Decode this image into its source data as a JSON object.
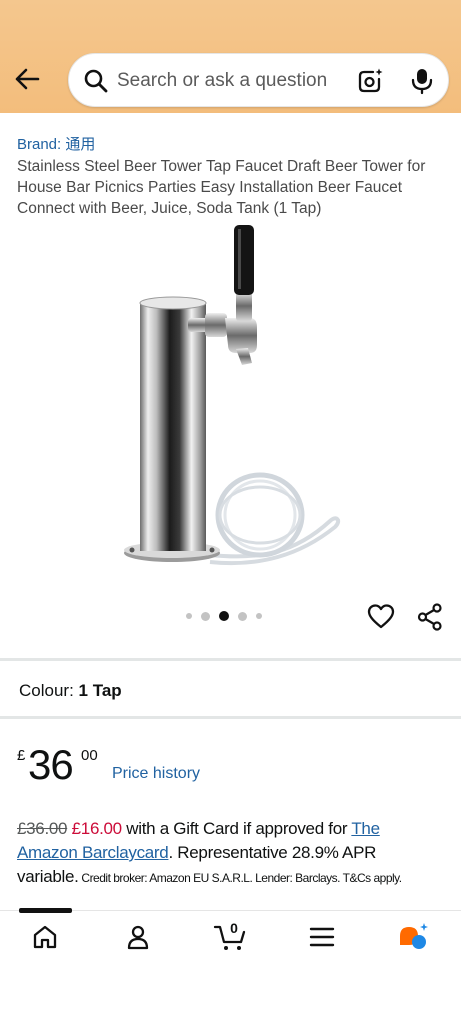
{
  "search": {
    "placeholder": "Search or ask a question"
  },
  "product": {
    "brand_label": "Brand: 通用",
    "title": "Stainless Steel Beer Tower Tap Faucet Draft Beer Tower for House Bar Picnics Parties Easy Installation Beer Faucet Connect with Beer, Juice, Soda Tank (1 Tap)",
    "image_count": 5,
    "active_image_index": 2
  },
  "variation": {
    "label": "Colour:",
    "value": "1 Tap"
  },
  "price": {
    "currency": "£",
    "whole": "36",
    "fraction": "00",
    "history_link": "Price history"
  },
  "promo": {
    "old_price": "£36.00",
    "new_price": "£16.00",
    "text1": " with a Gift Card if approved for ",
    "card_link": "The Amazon Barclaycard",
    "text2": ". Representative 28.9% APR variable.",
    "fine_print": " Credit broker: Amazon EU S.A.R.L. Lender: Barclays. T&Cs apply."
  },
  "nav": {
    "cart_count": "0",
    "items": [
      "home-icon",
      "account-icon",
      "cart-icon",
      "menu-icon",
      "rufus-icon"
    ]
  },
  "colors": {
    "topbar": "#f3bd7c",
    "link": "#2162a1",
    "deal_red": "#cc0c39"
  }
}
